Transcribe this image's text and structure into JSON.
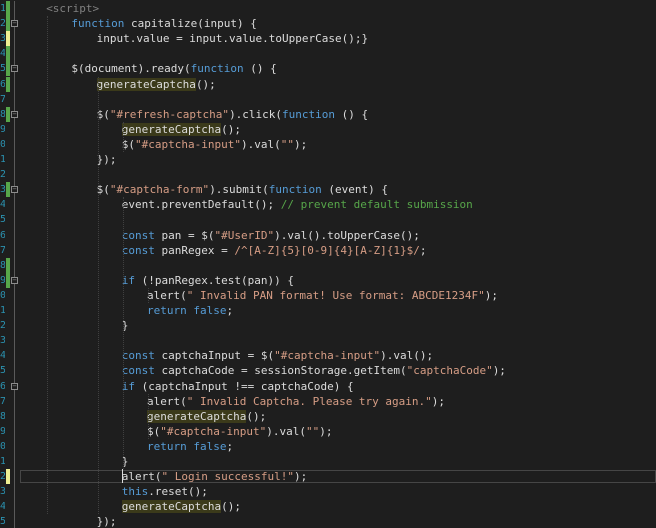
{
  "colors": {
    "background": "#1e1e1e",
    "plain": "#dcdcdc",
    "keyword": "#569cd6",
    "string": "#d69d85",
    "comment": "#57a64a",
    "tag": "#808080",
    "line_number": "#2b91af",
    "change_saved": "#57a64a",
    "change_unsaved": "#efef91"
  },
  "lines": [
    [
      {
        "t": "<script>",
        "c": "tag"
      }
    ],
    [
      {
        "t": "function",
        "c": "kw"
      },
      {
        "t": " capitalize(input) {",
        "c": "pl"
      }
    ],
    [
      {
        "t": "input.value = input.value.toUpperCase();}",
        "c": "pl"
      }
    ],
    [],
    [
      {
        "t": "$(document).ready(",
        "c": "pl"
      },
      {
        "t": "function",
        "c": "kw"
      },
      {
        "t": " () {",
        "c": "pl"
      }
    ],
    [
      {
        "t": "generateCaptcha",
        "c": "pl",
        "hl": true
      },
      {
        "t": "();",
        "c": "pl"
      }
    ],
    [],
    [
      {
        "t": "$(",
        "c": "pl"
      },
      {
        "t": "\"#refresh-captcha\"",
        "c": "str"
      },
      {
        "t": ").click(",
        "c": "pl"
      },
      {
        "t": "function",
        "c": "kw"
      },
      {
        "t": " () {",
        "c": "pl"
      }
    ],
    [
      {
        "t": "generateCaptcha",
        "c": "pl",
        "hl": true
      },
      {
        "t": "();",
        "c": "pl"
      }
    ],
    [
      {
        "t": "$(",
        "c": "pl"
      },
      {
        "t": "\"#captcha-input\"",
        "c": "str"
      },
      {
        "t": ").val(",
        "c": "pl"
      },
      {
        "t": "\"\"",
        "c": "str"
      },
      {
        "t": ");",
        "c": "pl"
      }
    ],
    [
      {
        "t": "});",
        "c": "pl"
      }
    ],
    [],
    [
      {
        "t": "$(",
        "c": "pl"
      },
      {
        "t": "\"#captcha-form\"",
        "c": "str"
      },
      {
        "t": ").submit(",
        "c": "pl"
      },
      {
        "t": "function",
        "c": "kw"
      },
      {
        "t": " (event) {",
        "c": "pl"
      }
    ],
    [
      {
        "t": "event.preventDefault(); ",
        "c": "pl"
      },
      {
        "t": "// prevent default submission",
        "c": "cm"
      }
    ],
    [],
    [
      {
        "t": "const",
        "c": "kw"
      },
      {
        "t": " pan = $(",
        "c": "pl"
      },
      {
        "t": "\"#UserID\"",
        "c": "str"
      },
      {
        "t": ").val().toUpperCase();",
        "c": "pl"
      }
    ],
    [
      {
        "t": "const",
        "c": "kw"
      },
      {
        "t": " panRegex = ",
        "c": "pl"
      },
      {
        "t": "/^[A-Z]{5}[0-9]{4}[A-Z]{1}$/",
        "c": "rx"
      },
      {
        "t": ";",
        "c": "pl"
      }
    ],
    [],
    [
      {
        "t": "if",
        "c": "kw"
      },
      {
        "t": " (!panRegex.test(pan)) {",
        "c": "pl"
      }
    ],
    [
      {
        "t": "alert(",
        "c": "pl"
      },
      {
        "t": "\" Invalid PAN format! Use format: ABCDE1234F\"",
        "c": "str"
      },
      {
        "t": ");",
        "c": "pl"
      }
    ],
    [
      {
        "t": "return",
        "c": "kw"
      },
      {
        "t": " ",
        "c": "pl"
      },
      {
        "t": "false",
        "c": "kw"
      },
      {
        "t": ";",
        "c": "pl"
      }
    ],
    [
      {
        "t": "}",
        "c": "pl"
      }
    ],
    [],
    [
      {
        "t": "const",
        "c": "kw"
      },
      {
        "t": " captchaInput = $(",
        "c": "pl"
      },
      {
        "t": "\"#captcha-input\"",
        "c": "str"
      },
      {
        "t": ").val();",
        "c": "pl"
      }
    ],
    [
      {
        "t": "const",
        "c": "kw"
      },
      {
        "t": " captchaCode = sessionStorage.getItem(",
        "c": "pl"
      },
      {
        "t": "\"captchaCode\"",
        "c": "str"
      },
      {
        "t": ");",
        "c": "pl"
      }
    ],
    [
      {
        "t": "if",
        "c": "kw"
      },
      {
        "t": " (captchaInput !== captchaCode) {",
        "c": "pl"
      }
    ],
    [
      {
        "t": "alert(",
        "c": "pl"
      },
      {
        "t": "\" Invalid Captcha. Please try again.\"",
        "c": "str"
      },
      {
        "t": ");",
        "c": "pl"
      }
    ],
    [
      {
        "t": "generateCaptcha",
        "c": "pl",
        "hl": true
      },
      {
        "t": "();",
        "c": "pl"
      }
    ],
    [
      {
        "t": "$(",
        "c": "pl"
      },
      {
        "t": "\"#captcha-input\"",
        "c": "str"
      },
      {
        "t": ").val(",
        "c": "pl"
      },
      {
        "t": "\"\"",
        "c": "str"
      },
      {
        "t": ");",
        "c": "pl"
      }
    ],
    [
      {
        "t": "return",
        "c": "kw"
      },
      {
        "t": " ",
        "c": "pl"
      },
      {
        "t": "false",
        "c": "kw"
      },
      {
        "t": ";",
        "c": "pl"
      }
    ],
    [
      {
        "t": "}",
        "c": "pl"
      }
    ],
    [
      {
        "t": "alert(",
        "c": "pl"
      },
      {
        "t": "\" Login successful!\"",
        "c": "str"
      },
      {
        "t": ");",
        "c": "pl"
      }
    ],
    [
      {
        "t": "this",
        "c": "kw"
      },
      {
        "t": ".reset();",
        "c": "pl"
      }
    ],
    [
      {
        "t": "generateCaptcha",
        "c": "pl",
        "hl": true
      },
      {
        "t": "();",
        "c": "pl"
      }
    ],
    [
      {
        "t": "});",
        "c": "pl"
      }
    ]
  ],
  "line_numbers": [
    "1",
    "2",
    "3",
    "4",
    "5",
    "6",
    "7",
    "8",
    "9",
    "0",
    "1",
    "2",
    "3",
    "4",
    "5",
    "6",
    "7",
    "8",
    "9",
    "0",
    "1",
    "2",
    "3",
    "4",
    "5",
    "6",
    "7",
    "8",
    "9",
    "0",
    "1",
    "2",
    "3",
    "4",
    "5"
  ]
}
